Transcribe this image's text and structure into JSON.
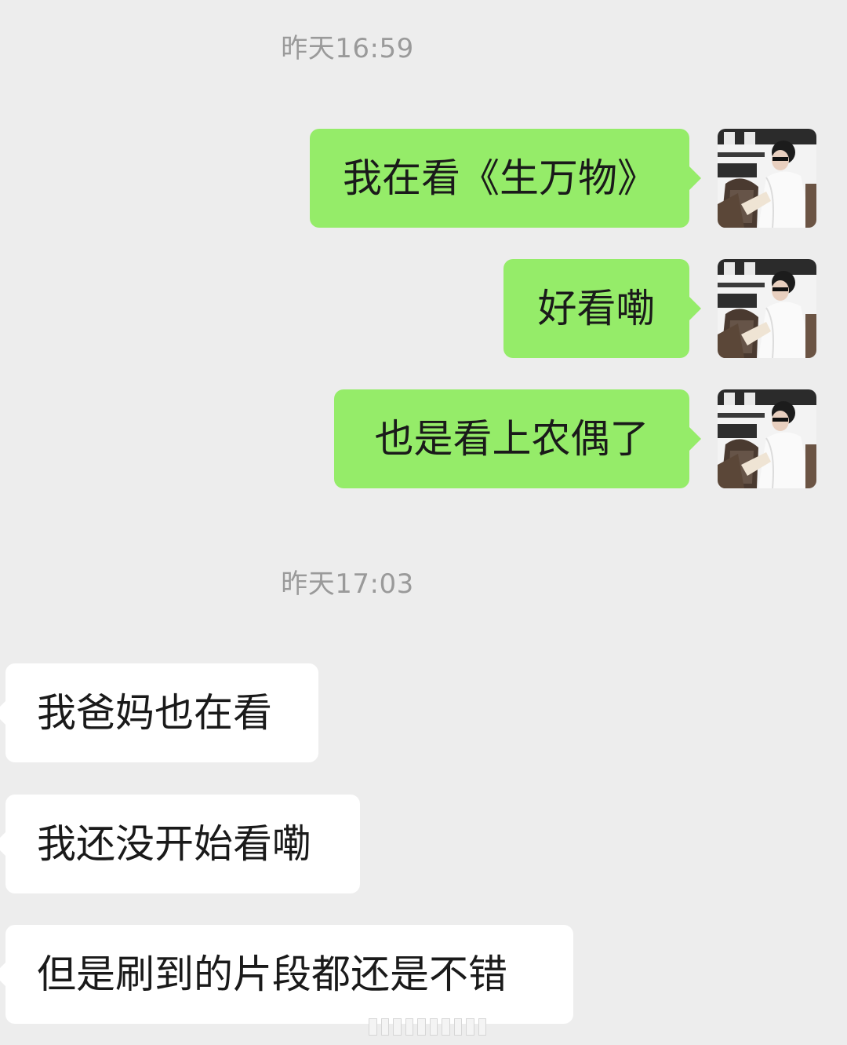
{
  "chat": {
    "timestamp_1": "昨天16:59",
    "timestamp_2": "昨天17:03",
    "sent_messages": [
      {
        "text": "我在看《生万物》"
      },
      {
        "text": "好看嘞"
      },
      {
        "text": "也是看上农偶了"
      }
    ],
    "received_messages": [
      {
        "text": "我爸妈也在看"
      },
      {
        "text": "我还没开始看嘞"
      },
      {
        "text": "但是刷到的片段都还是不错"
      }
    ],
    "avatar_icon": "user-avatar-photo"
  },
  "colors": {
    "background": "#ededed",
    "sent_bubble": "#95ec69",
    "received_bubble": "#ffffff",
    "timestamp_text": "#9a9a9a",
    "message_text": "#1a1a1a"
  }
}
